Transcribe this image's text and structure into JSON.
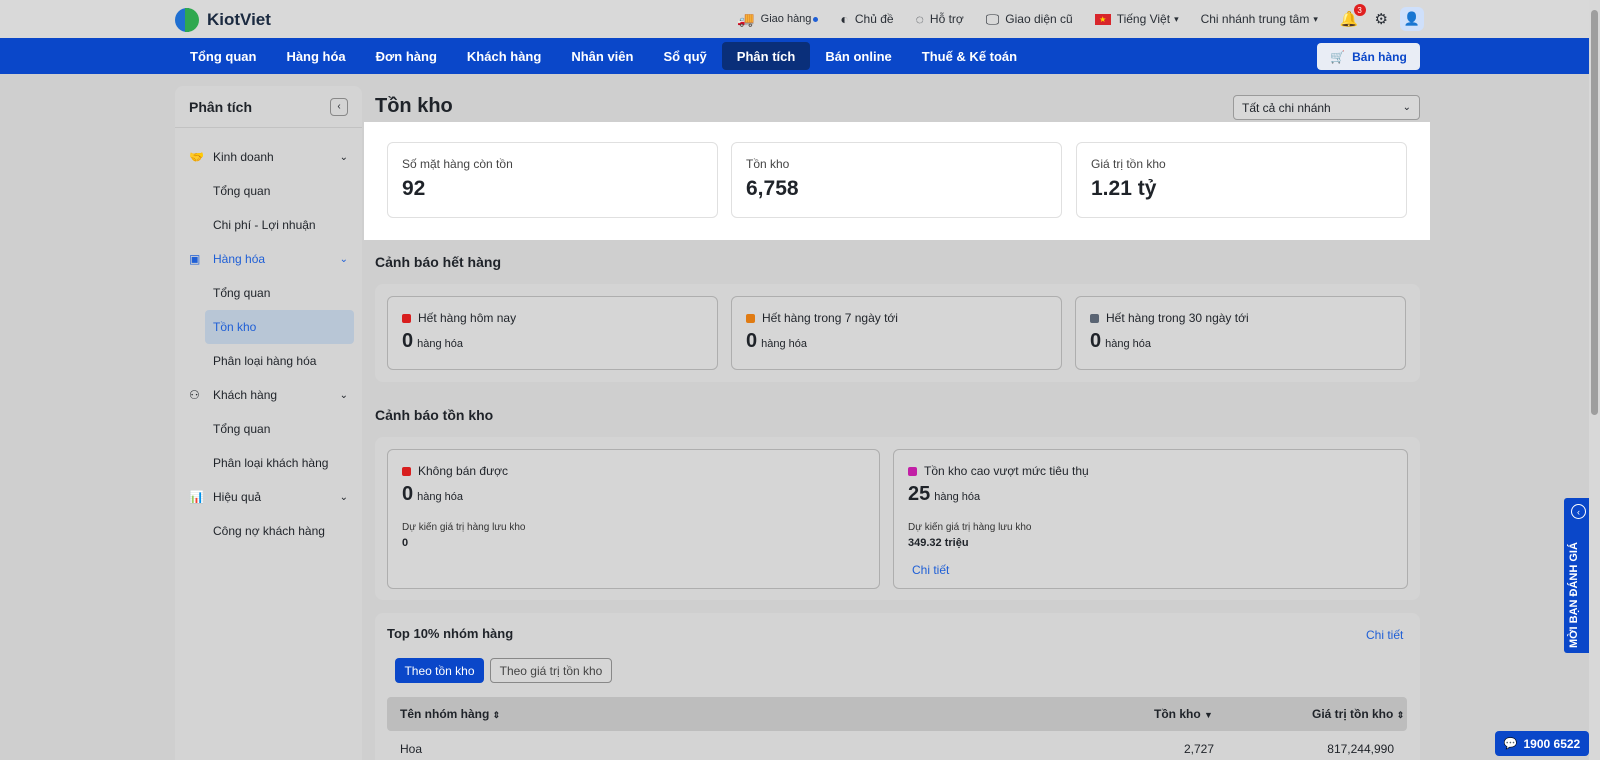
{
  "app": {
    "logo_text": "KiotViet"
  },
  "topbar": {
    "delivery": "Giao hàng",
    "theme": "Chủ đề",
    "support": "Hỗ trợ",
    "old_ui": "Giao diện cũ",
    "language": "Tiếng Việt",
    "branch": "Chi nhánh trung tâm",
    "notification_count": "3"
  },
  "nav": {
    "items": [
      "Tổng quan",
      "Hàng hóa",
      "Đơn hàng",
      "Khách hàng",
      "Nhân viên",
      "Sổ quỹ",
      "Phân tích",
      "Bán online",
      "Thuế & Kế toán"
    ],
    "active_index": 6,
    "sell_button": "Bán hàng"
  },
  "sidebar": {
    "title": "Phân tích",
    "groups": [
      {
        "label": "Kinh doanh",
        "icon": "handshake-icon",
        "subs": [
          "Tổng quan",
          "Chi phí - Lợi nhuận"
        ]
      },
      {
        "label": "Hàng hóa",
        "icon": "box-icon",
        "subs": [
          "Tổng quan",
          "Tồn kho",
          "Phân loại hàng hóa"
        ]
      },
      {
        "label": "Khách hàng",
        "icon": "users-icon",
        "subs": [
          "Tổng quan",
          "Phân loại khách hàng"
        ]
      },
      {
        "label": "Hiệu quả",
        "icon": "performance-icon",
        "subs": [
          "Công nợ khách hàng"
        ]
      }
    ]
  },
  "main": {
    "title": "Tồn kho",
    "branch_filter": "Tất cả chi nhánh",
    "kpis": [
      {
        "label": "Số mặt hàng còn tồn",
        "value": "92"
      },
      {
        "label": "Tồn kho",
        "value": "6,758"
      },
      {
        "label": "Giá trị tồn kho",
        "value": "1.21 tỷ"
      }
    ],
    "out_of_stock": {
      "title": "Cảnh báo hết hàng",
      "cards": [
        {
          "label": "Hết hàng hôm nay",
          "count": "0",
          "unit": "hàng hóa",
          "color": "#d81e1e"
        },
        {
          "label": "Hết hàng trong 7 ngày tới",
          "count": "0",
          "unit": "hàng hóa",
          "color": "#e07b13"
        },
        {
          "label": "Hết hàng trong 30 ngày tới",
          "count": "0",
          "unit": "hàng hóa",
          "color": "#5a6473"
        }
      ]
    },
    "stock_warning": {
      "title": "Cảnh báo tồn kho",
      "cards": [
        {
          "label": "Không bán được",
          "count": "0",
          "unit": "hàng hóa",
          "note": "Dự kiến giá trị hàng lưu kho",
          "note_value": "0",
          "color": "#d81e1e"
        },
        {
          "label": "Tồn kho cao vượt mức tiêu thụ",
          "count": "25",
          "unit": "hàng hóa",
          "note": "Dự kiến giá trị hàng lưu kho",
          "note_value": "349.32 triệu",
          "link": "Chi tiết",
          "color": "#c21fa6"
        }
      ]
    },
    "top_groups": {
      "title": "Top 10% nhóm hàng",
      "detail_link": "Chi tiết",
      "tabs": [
        "Theo tồn kho",
        "Theo giá trị tồn kho"
      ],
      "columns": [
        "Tên nhóm hàng",
        "Tồn kho",
        "Giá trị tồn kho"
      ],
      "rows": [
        {
          "name": "Hoa",
          "stock": "2,727",
          "value": "817,244,990"
        }
      ]
    }
  },
  "floating": {
    "feedback": "MỜI BẠN ĐÁNH GIÁ",
    "hotline": "1900 6522"
  },
  "colors": {
    "primary": "#0a47c9",
    "link": "#1f5fd6"
  }
}
